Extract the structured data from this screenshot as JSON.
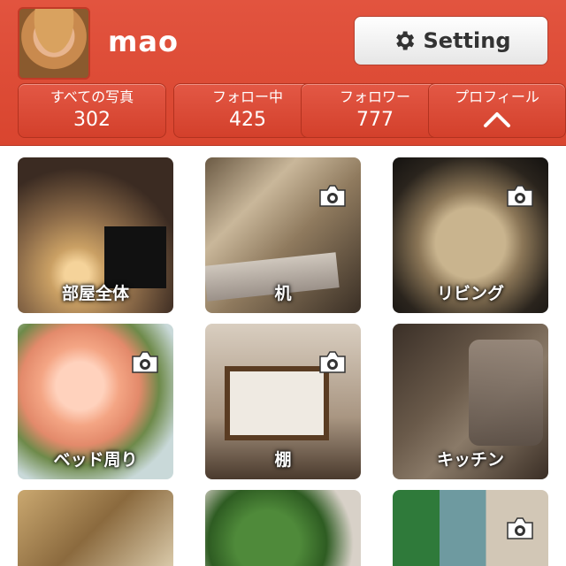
{
  "profile": {
    "username": "mao",
    "setting_label": "Setting"
  },
  "stats": [
    {
      "title": "すべての写真",
      "value": "302"
    },
    {
      "title": "フォロー中",
      "value": "425"
    },
    {
      "title": "フォロワー",
      "value": "777"
    },
    {
      "title": "プロフィール",
      "icon": "chevron-up-icon"
    }
  ],
  "albums": [
    {
      "label": "部屋全体",
      "camera": false
    },
    {
      "label": "机",
      "camera": true
    },
    {
      "label": "リビング",
      "camera": true
    },
    {
      "label": "ベッド周り",
      "camera": true
    },
    {
      "label": "棚",
      "camera": true
    },
    {
      "label": "キッチン",
      "camera": false
    },
    {
      "label": "",
      "camera": false
    },
    {
      "label": "",
      "camera": false
    },
    {
      "label": "",
      "camera": true
    }
  ],
  "colors": {
    "header": "#d9452f",
    "button_text": "#333333"
  }
}
